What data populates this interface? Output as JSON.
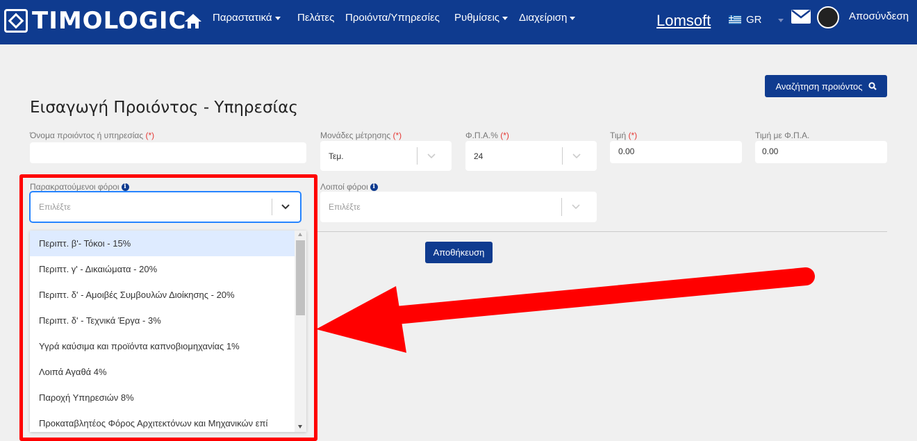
{
  "navbar": {
    "brand": "TIMOLOGIC",
    "menu": [
      {
        "label": "Παραστατικά",
        "dropdown": true
      },
      {
        "label": "Πελάτες",
        "dropdown": false
      },
      {
        "label": "Προιόντα/Υπηρεσίες",
        "dropdown": false
      },
      {
        "label": "Ρυθμίσεις",
        "dropdown": true
      },
      {
        "label": "Διαχείριση",
        "dropdown": true
      }
    ],
    "company": "Lomsoft",
    "language": "GR",
    "logout": "Αποσύνδεση"
  },
  "search_button": "Αναζήτηση προιόντος",
  "page_title": "Εισαγωγή Προιόντος - Υπηρεσίας",
  "form": {
    "name": {
      "label": "Όνομα προιόντος ή υπηρεσίας",
      "required": "(*)",
      "value": ""
    },
    "unit": {
      "label": "Μονάδες μέτρησης",
      "required": "(*)",
      "value": "Τεμ."
    },
    "vat": {
      "label": "Φ.Π.Α.%",
      "required": "(*)",
      "value": "24"
    },
    "price": {
      "label": "Τιμή",
      "required": "(*)",
      "value": "0.00"
    },
    "price_vat": {
      "label": "Τιμή με Φ.Π.Α.",
      "value": "0.00"
    },
    "withholding": {
      "label": "Παρακρατούμενοι φόροι",
      "placeholder": "Επιλέξτε"
    },
    "other_taxes": {
      "label": "Λοιποί φόροι",
      "placeholder": "Επιλέξτε"
    },
    "save": "Αποθήκευση"
  },
  "dropdown_options": [
    "Περιπτ. β'- Τόκοι - 15%",
    "Περιπτ. γ' - Δικαιώματα - 20%",
    "Περιπτ. δ' - Αμοιβές Συμβουλών Διοίκησης - 20%",
    "Περιπτ. δ' - Τεχνικά Έργα - 3%",
    "Υγρά καύσιμα και προϊόντα καπνοβιομηχανίας 1%",
    "Λοιπά Αγαθά 4%",
    "Παροχή Υπηρεσιών 8%",
    "Προκαταβλητέος Φόρος Αρχιτεκτόνων και Μηχανικών επί"
  ],
  "colors": {
    "navbar": "#0f3b8f",
    "annotation": "#ff0000",
    "highlight": "#deebff"
  }
}
